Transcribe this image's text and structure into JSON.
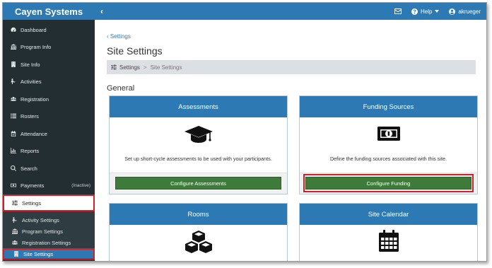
{
  "app": {
    "brand": "Cayen Systems"
  },
  "topbar": {
    "help_label": "Help",
    "user_name": "akrueger"
  },
  "sidebar": {
    "items": [
      {
        "label": "Dashboard",
        "icon": "dashboard-icon"
      },
      {
        "label": "Program Info",
        "icon": "building-icon"
      },
      {
        "label": "Site Info",
        "icon": "site-icon"
      },
      {
        "label": "Activities",
        "icon": "activities-icon"
      },
      {
        "label": "Registration",
        "icon": "users-icon"
      },
      {
        "label": "Rosters",
        "icon": "list-icon"
      },
      {
        "label": "Attendance",
        "icon": "calendar-check-icon"
      },
      {
        "label": "Reports",
        "icon": "bar-chart-icon"
      },
      {
        "label": "Search",
        "icon": "search-icon"
      },
      {
        "label": "Payments",
        "icon": "money-icon",
        "tag": "(Inactive)"
      },
      {
        "label": "Settings",
        "icon": "sliders-icon",
        "active": true
      }
    ],
    "sub_items": [
      {
        "label": "Activity Settings",
        "icon": "activities-icon"
      },
      {
        "label": "Program Settings",
        "icon": "building-icon"
      },
      {
        "label": "Registration Settings",
        "icon": "users-icon"
      },
      {
        "label": "Site Settings",
        "icon": "site-icon",
        "current": true
      }
    ]
  },
  "main": {
    "back_link": "Settings",
    "title": "Site Settings",
    "breadcrumb": {
      "root": "Settings",
      "separator": ">",
      "current": "Site Settings"
    },
    "section_title": "General",
    "cards": [
      {
        "title": "Assessments",
        "icon": "graduation-cap-icon",
        "description": "Set up short-cycle assessments to be used with your participants.",
        "button": "Configure Assessments"
      },
      {
        "title": "Funding Sources",
        "icon": "money-bill-icon",
        "description": "Define the funding sources associated with this site.",
        "button": "Configure Funding",
        "highlighted": true
      },
      {
        "title": "Rooms",
        "icon": "cubes-icon"
      },
      {
        "title": "Site Calendar",
        "icon": "calendar-icon"
      }
    ]
  },
  "colors": {
    "primary": "#2d79b3",
    "sidebar": "#232e33",
    "button": "#3e7a3a",
    "highlight": "#d0202a"
  }
}
